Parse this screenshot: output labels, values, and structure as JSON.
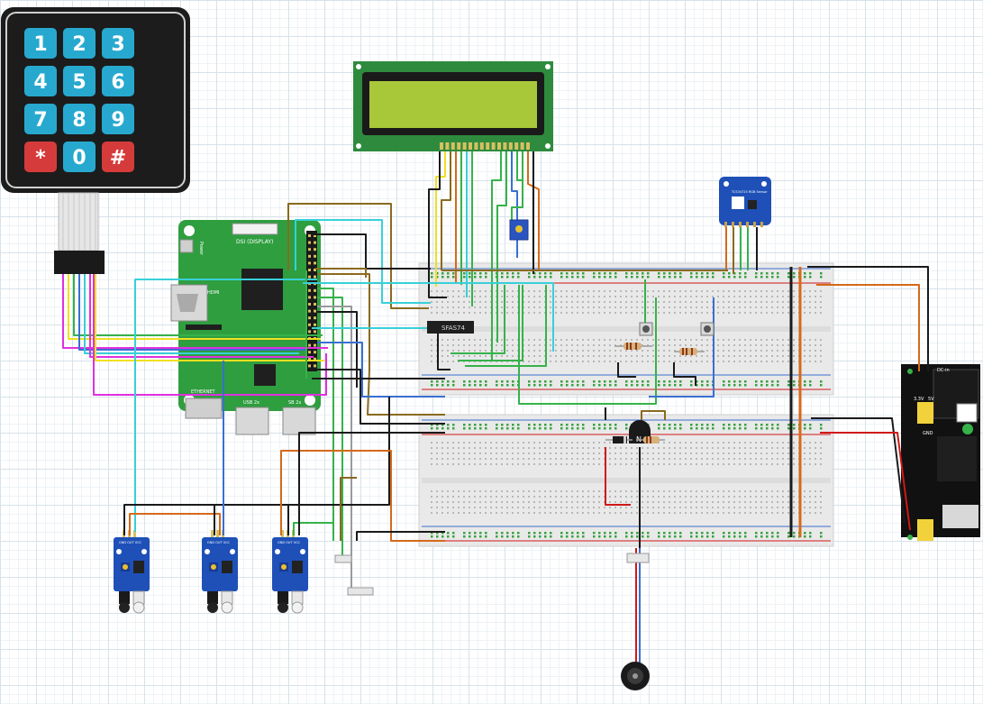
{
  "keypad": {
    "keys": [
      {
        "label": "1",
        "color": "#27a9cf"
      },
      {
        "label": "2",
        "color": "#27a9cf"
      },
      {
        "label": "3",
        "color": "#27a9cf"
      },
      {
        "label": "4",
        "color": "#27a9cf"
      },
      {
        "label": "5",
        "color": "#27a9cf"
      },
      {
        "label": "6",
        "color": "#27a9cf"
      },
      {
        "label": "7",
        "color": "#27a9cf"
      },
      {
        "label": "8",
        "color": "#27a9cf"
      },
      {
        "label": "9",
        "color": "#27a9cf"
      },
      {
        "label": "*",
        "color": "#d63b3b"
      },
      {
        "label": "0",
        "color": "#27a9cf"
      },
      {
        "label": "#",
        "color": "#d63b3b"
      }
    ]
  },
  "raspberry_pi": {
    "board_color": "#2f9e3f",
    "dsi_label": "DSI (DISPLAY)",
    "power_label": "Power",
    "hdmi_label": "HDMI",
    "ethernet_label": "ETHERNET",
    "usb_label_1": "USB 2x",
    "usb_label_2": "SB 2x"
  },
  "lcd": {
    "screen_color": "#a8c83a",
    "board_color": "#2e8b3e"
  },
  "ic_chip": {
    "label": "SFAS74"
  },
  "rgb_sensor": {
    "label": "TCS34725 RGB Sensor"
  },
  "power_module": {
    "label_dc": "DC-in",
    "label_gnd": "GND",
    "label_33": "3.3V",
    "label_5": "5V"
  },
  "ir_sensors": [
    {
      "label": "GND OUT VCC"
    },
    {
      "label": "GND OUT VCC"
    },
    {
      "label": "GND OUT VCC"
    }
  ],
  "wire_colors": {
    "black": "#1a1a1a",
    "brown": "#8a6a1f",
    "yellow": "#f0e020",
    "green": "#36b24a",
    "cyan": "#38d0d8",
    "blue": "#3a6fd0",
    "orange": "#d46a1a",
    "red": "#d01818",
    "magenta": "#e030e0",
    "gray": "#9a9a9a",
    "white": "#e8e8e8"
  }
}
